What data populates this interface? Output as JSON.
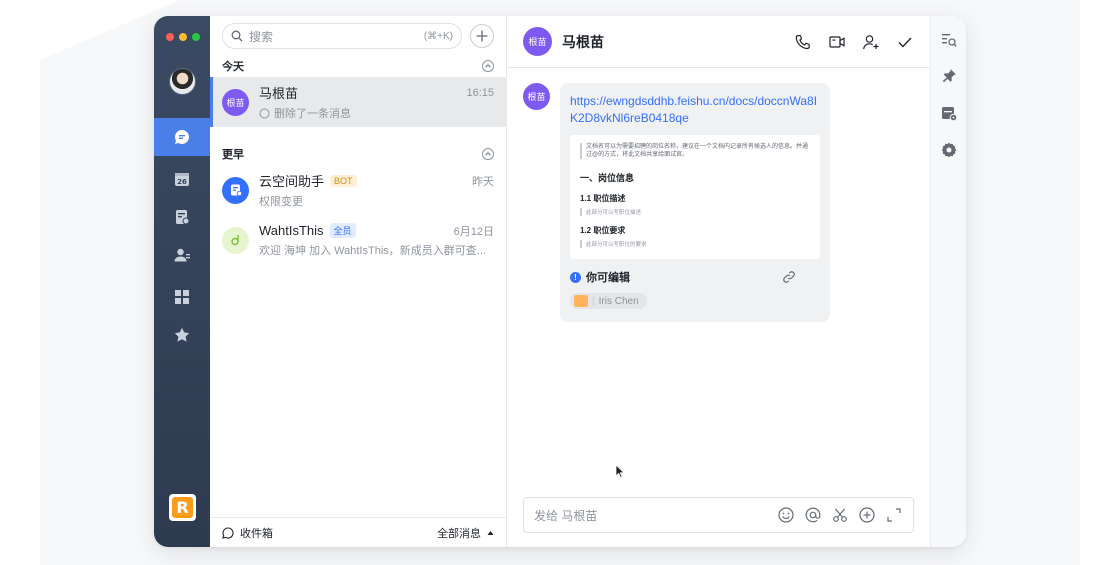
{
  "search": {
    "placeholder": "搜索",
    "shortcut": "(⌘+K)"
  },
  "sections": {
    "today": "今天",
    "earlier": "更早"
  },
  "chats": [
    {
      "name": "马根苗",
      "avatar_text": "根苗",
      "avatar_color": "#7f5af0",
      "time": "16:15",
      "preview": "删除了一条消息"
    },
    {
      "name": "云空间助手",
      "badge": "BOT",
      "time": "昨天",
      "preview": "权限变更",
      "avatar_color": "#3370ff"
    },
    {
      "name": "WahtIsThis",
      "badge": "全员",
      "time": "6月12日",
      "preview": "欢迎 海坤 加入 WahtIsThis，新成员入群可查...",
      "avatar_color": "#e6f5d0"
    }
  ],
  "footer": {
    "inbox": "收件箱",
    "filter": "全部消息"
  },
  "conversation": {
    "title": "马根苗",
    "avatar_text": "根苗",
    "link": "https://ewngdsddhb.feishu.cn/docs/doccnWa8IK2D8vkNl6reB0418qe",
    "doc_preview": {
      "note": "文档名可以为需要招聘的岗位名称，建议在一个文档内记录所有候选人的信息。并通过@的方式，将此文档共享给面试官。",
      "h1": "一、岗位信息",
      "h2a": "1.1 职位描述",
      "pa": "此部分可以写职位描述",
      "h2b": "1.2 职位要求",
      "pb": "此部分可以写职位的要求"
    },
    "permission": "你可编辑",
    "owner": "Iris Chen",
    "composer_placeholder": "发给 马根苗"
  },
  "icons": {
    "header": [
      "phone-icon",
      "video-icon",
      "add-member-icon",
      "check-icon"
    ],
    "composer": [
      "emoji-icon",
      "mention-icon",
      "scissors-icon",
      "plus-circle-icon",
      "expand-icon"
    ],
    "tools": [
      "search-list-icon",
      "pin-icon",
      "calendar-settings-icon",
      "gear-icon"
    ],
    "rail": [
      "chat-icon",
      "calendar-icon",
      "docs-icon",
      "contacts-icon",
      "apps-icon",
      "star-icon"
    ]
  },
  "rail": {
    "calendar_day": "26"
  },
  "colors": {
    "accent": "#4a7ee8",
    "link": "#3370ff",
    "rail": "#34425a"
  }
}
